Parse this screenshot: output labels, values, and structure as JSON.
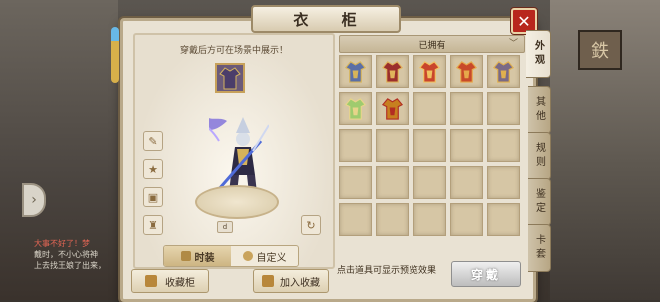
{
  "window": {
    "title": "衣 柜",
    "close": "✕"
  },
  "preview": {
    "hint": "穿戴后方可在场景中展示！",
    "mini_chip": "d",
    "segments": [
      {
        "label": "时装",
        "active": true
      },
      {
        "label": "自定义",
        "active": false
      }
    ],
    "side_icons": [
      "brush-icon",
      "star-icon",
      "lock-icon",
      "shirt-icon"
    ]
  },
  "buttons": {
    "collection_cabinet": "收藏柜",
    "add_to_collection": "加入收藏",
    "wear": "穿戴"
  },
  "owned": {
    "label": "已拥有",
    "hint": "点击道具可显示预览效果",
    "items": [
      {
        "color": "#5b6fa6",
        "trim": "#d6b45a"
      },
      {
        "color": "#9b2f2c",
        "trim": "#e0b35b"
      },
      {
        "color": "#c9452c",
        "trim": "#f0c060"
      },
      {
        "color": "#c84a2a",
        "trim": "#e6a84a"
      },
      {
        "color": "#7a6a86",
        "trim": "#e0b04e"
      },
      {
        "color": "#9fcb6e",
        "trim": "#e7d48a"
      },
      {
        "color": "#c77f1f",
        "trim": "#b22d22"
      }
    ],
    "total_cells": 25
  },
  "tabs": [
    "外观",
    "其他",
    "规则",
    "鉴定",
    "卡套"
  ],
  "background": {
    "sign": "鉄",
    "chat": [
      "大事不好了！梦",
      "戴时，不小心将神",
      "上去找王娘了出来，"
    ]
  }
}
